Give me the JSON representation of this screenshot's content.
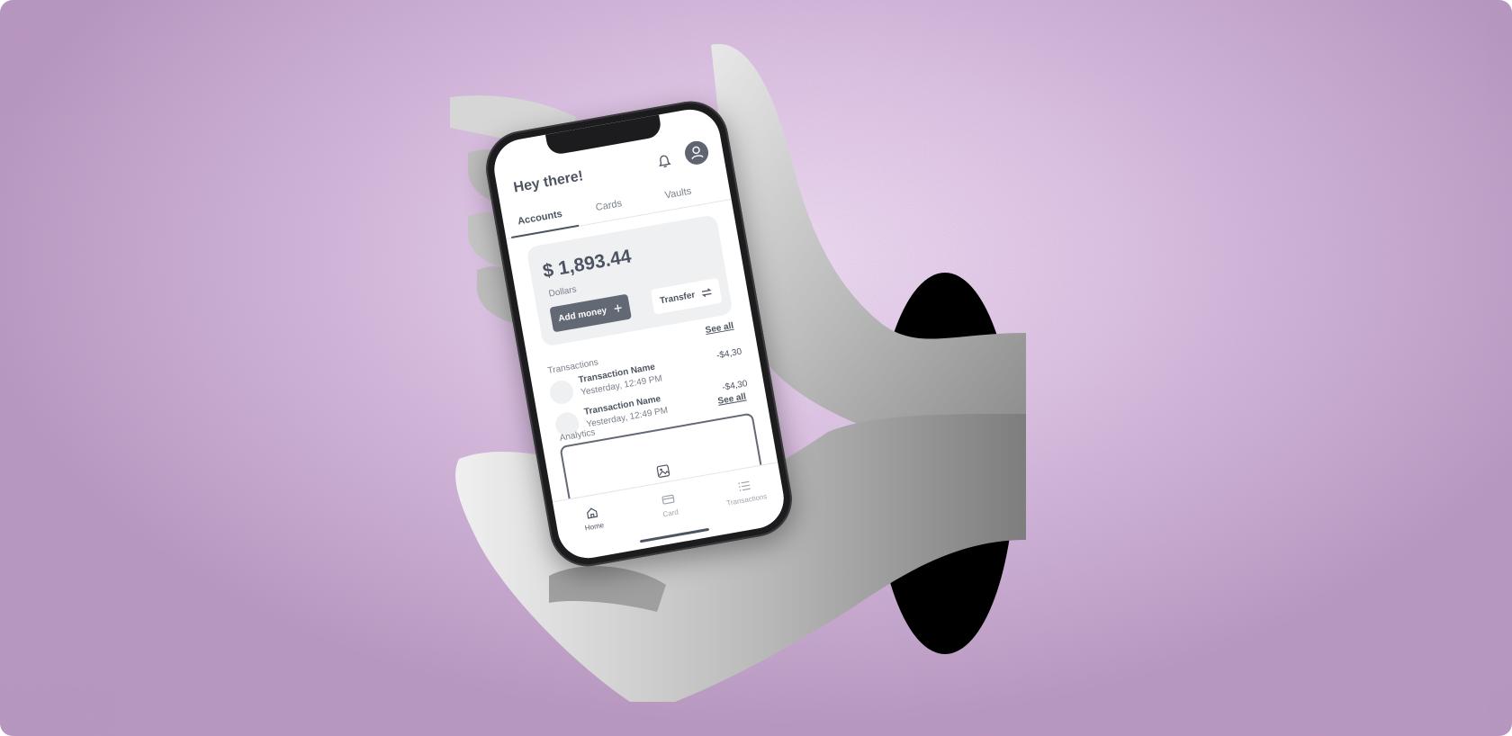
{
  "app": {
    "greeting": "Hey there!"
  },
  "tabs": [
    {
      "label": "Accounts",
      "active": true
    },
    {
      "label": "Cards",
      "active": false
    },
    {
      "label": "Vaults",
      "active": false
    }
  ],
  "balance_card": {
    "amount": "$ 1,893.44",
    "currency": "Dollars",
    "add_money_label": "Add money",
    "transfer_label": "Transfer"
  },
  "transactions": {
    "title": "Transactions",
    "see_all_label": "See all",
    "items": [
      {
        "name": "Transaction Name",
        "time": "Yesterday, 12:49 PM",
        "amount": "-$4,30"
      },
      {
        "name": "Transaction Name",
        "time": "Yesterday, 12:49 PM",
        "amount": "-$4,30"
      }
    ]
  },
  "analytics": {
    "title": "Analytics",
    "see_all_label": "See all"
  },
  "bottom_nav": [
    {
      "label": "Home",
      "icon": "home-icon",
      "active": true
    },
    {
      "label": "Card",
      "icon": "card-icon",
      "active": false
    },
    {
      "label": "Transactions",
      "icon": "list-icon",
      "active": false
    }
  ],
  "colors": {
    "background": "#d9c1e0",
    "text_primary": "#4d5461",
    "button_dark": "#626874",
    "card_bg": "#eef0f2"
  }
}
